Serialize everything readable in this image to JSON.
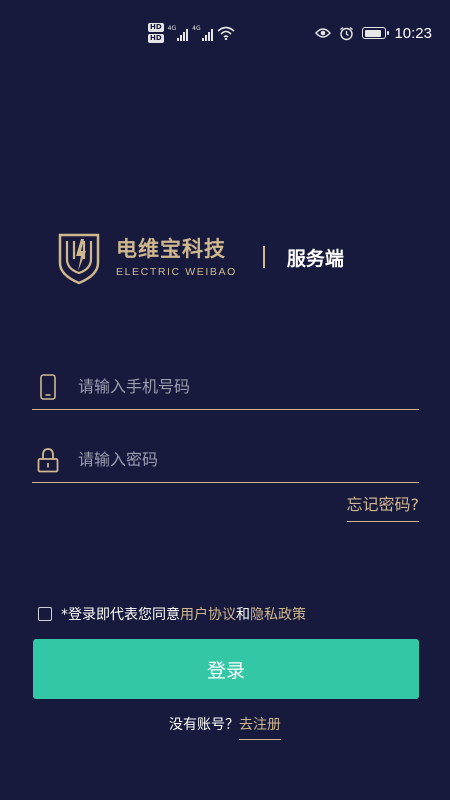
{
  "status_bar": {
    "time": "10:23",
    "hd_badges": [
      "HD",
      "HD"
    ],
    "network_labels": [
      "4G",
      "4G"
    ],
    "battery_level": 0.85,
    "icons": [
      "eye-icon",
      "alarm-icon",
      "wifi-icon",
      "battery-icon"
    ]
  },
  "brand": {
    "name_cn": "电维宝科技",
    "name_en": "ELECTRIC WEIBAO",
    "subtitle": "服务端",
    "gold_color": "#cfb78e"
  },
  "form": {
    "phone_placeholder": "请输入手机号码",
    "phone_value": "",
    "password_placeholder": "请输入密码",
    "password_value": "",
    "forgot_label": "忘记密码?"
  },
  "agreement": {
    "checked": false,
    "prefix": "*登录即代表您同意",
    "user_agreement": "用户协议",
    "and": "和",
    "privacy_policy": "隐私政策"
  },
  "login": {
    "label": "登录",
    "color": "#33c7a6"
  },
  "register": {
    "question": "没有账号？",
    "link_label": "去注册"
  },
  "colors": {
    "background": "#171a3c",
    "accent_gold": "#cfb78e",
    "primary_green": "#33c7a6"
  }
}
